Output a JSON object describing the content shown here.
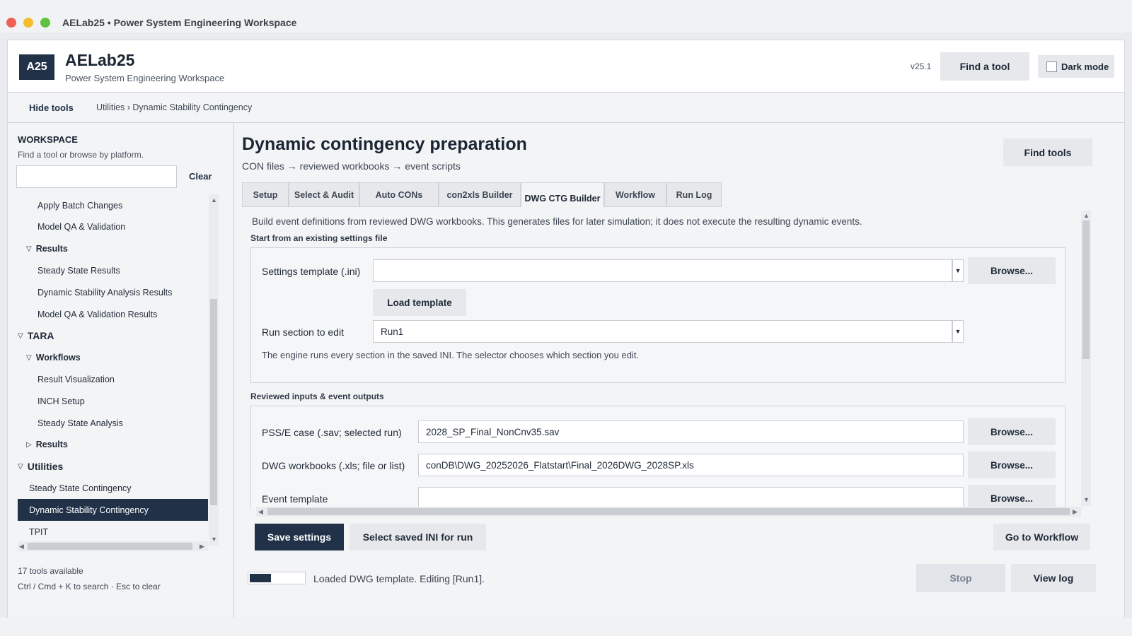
{
  "window": {
    "title": "AELab25 • Power System Engineering Workspace"
  },
  "header": {
    "logo": "A25",
    "app_name": "AELab25",
    "subtitle": "Power System Engineering Workspace",
    "version": "v25.1",
    "find_tool": "Find a tool",
    "dark_mode": "Dark mode"
  },
  "crumbbar": {
    "hide_tools": "Hide tools",
    "breadcrumb": "Utilities › Dynamic Stability Contingency"
  },
  "sidebar": {
    "title": "WORKSPACE",
    "subtitle": "Find a tool or browse by platform.",
    "search_value": "",
    "clear": "Clear",
    "items": [
      {
        "label": "Apply Batch Changes",
        "level": 2,
        "toggle": ""
      },
      {
        "label": "Model QA & Validation",
        "level": 2,
        "toggle": ""
      },
      {
        "label": "Results",
        "level": 1,
        "toggle": "open",
        "bold": true
      },
      {
        "label": "Steady State Results",
        "level": 2,
        "toggle": ""
      },
      {
        "label": "Dynamic Stability Analysis Results",
        "level": 2,
        "toggle": ""
      },
      {
        "label": "Model QA & Validation Results",
        "level": 2,
        "toggle": ""
      },
      {
        "label": "TARA",
        "level": 0,
        "toggle": "open",
        "bold": true
      },
      {
        "label": "Workflows",
        "level": 1,
        "toggle": "open",
        "bold": true
      },
      {
        "label": "Result Visualization",
        "level": 2,
        "toggle": ""
      },
      {
        "label": "INCH Setup",
        "level": 2,
        "toggle": ""
      },
      {
        "label": "Steady State Analysis",
        "level": 2,
        "toggle": ""
      },
      {
        "label": "Results",
        "level": 1,
        "toggle": "closed",
        "bold": true
      },
      {
        "label": "Utilities",
        "level": 0,
        "toggle": "open",
        "bold": true
      },
      {
        "label": "Steady State Contingency",
        "level": 1,
        "toggle": ""
      },
      {
        "label": "Dynamic Stability Contingency",
        "level": 1,
        "toggle": "",
        "selected": true
      },
      {
        "label": "TPIT",
        "level": 1,
        "toggle": ""
      }
    ],
    "tools_count": "17 tools available",
    "shortcut": "Ctrl / Cmd + K to search · Esc to clear"
  },
  "main": {
    "title": "Dynamic contingency preparation",
    "subtitle": "CON files → reviewed workbooks → event scripts",
    "find_tools": "Find tools",
    "tabs": [
      {
        "label": "Setup"
      },
      {
        "label": "Select & Audit"
      },
      {
        "label": "Auto CONs"
      },
      {
        "label": "con2xls Builder"
      },
      {
        "label": "DWG CTG Builder",
        "active": true
      },
      {
        "label": "Workflow"
      },
      {
        "label": "Run Log"
      }
    ],
    "intro": "Build event definitions from reviewed DWG workbooks. This generates files for later simulation; it does not execute the resulting dynamic events.",
    "settings_section": {
      "label": "Start from an existing settings file",
      "template_label": "Settings template (.ini)",
      "template_value": "",
      "browse": "Browse...",
      "load_template": "Load template",
      "run_section_label": "Run section to edit",
      "run_section_value": "Run1",
      "note": "The engine runs every section in the saved INI. The selector chooses which section you edit."
    },
    "inputs_section": {
      "label": "Reviewed inputs & event outputs",
      "rows": [
        {
          "label": "PSS/E case (.sav; selected run)",
          "value": "2028_SP_Final_NonCnv35.sav",
          "browse": "Browse..."
        },
        {
          "label": "DWG workbooks (.xls; file or list)",
          "value": "conDB\\DWG_20252026_Flatstart\\Final_2026DWG_2028SP.xls",
          "browse": "Browse..."
        },
        {
          "label": "Event template",
          "value": "",
          "browse": "Browse..."
        }
      ]
    },
    "actions": {
      "save": "Save settings",
      "select_ini": "Select saved INI for run",
      "goto_workflow": "Go to Workflow",
      "stop": "Stop",
      "view_log": "View log"
    },
    "progress": 0.4,
    "status": "Loaded DWG template. Editing [Run1]."
  },
  "colors": {
    "accent": "#213147",
    "selected_bg": "#213147",
    "button_bg": "#e6e8ec"
  }
}
